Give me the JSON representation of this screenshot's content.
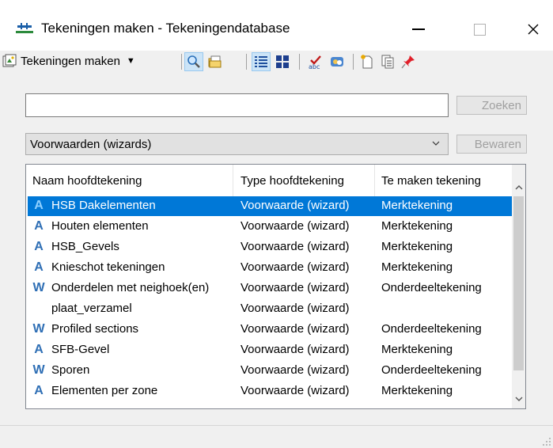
{
  "window": {
    "title": "Tekeningen maken - Tekeningendatabase",
    "app_icon": "drawing-app-icon",
    "controls": [
      "minimize-icon",
      "maximize-icon",
      "close-icon"
    ]
  },
  "toolbar": {
    "dropdown_label": "Tekeningen maken",
    "buttons": [
      {
        "name": "search-icon",
        "active": true
      },
      {
        "name": "folder-open-icon"
      },
      {
        "name": "list-view-icon",
        "active": true
      },
      {
        "name": "grid-view-icon"
      },
      {
        "name": "spellcheck-icon"
      },
      {
        "name": "replace-icon"
      },
      {
        "name": "new-document-icon"
      },
      {
        "name": "copy-document-icon"
      },
      {
        "name": "pin-icon"
      }
    ]
  },
  "search": {
    "value": "",
    "button_label": "Zoeken"
  },
  "filter": {
    "selected": "Voorwaarden (wizards)",
    "save_label": "Bewaren"
  },
  "list": {
    "columns": [
      "Naam hoofdtekening",
      "Type hoofdtekening",
      "Te maken tekening"
    ],
    "rows": [
      {
        "icon": "A",
        "name": "HSB Dakelementen",
        "type": "Voorwaarde (wizard)",
        "target": "Merktekening",
        "selected": true
      },
      {
        "icon": "A",
        "name": "Houten elementen",
        "type": "Voorwaarde (wizard)",
        "target": "Merktekening"
      },
      {
        "icon": "A",
        "name": "HSB_Gevels",
        "type": "Voorwaarde (wizard)",
        "target": "Merktekening"
      },
      {
        "icon": "A",
        "name": "Knieschot tekeningen",
        "type": "Voorwaarde (wizard)",
        "target": "Merktekening"
      },
      {
        "icon": "W",
        "name": "Onderdelen met neighoek(en)",
        "type": "Voorwaarde (wizard)",
        "target": "Onderdeeltekening"
      },
      {
        "icon": "",
        "name": "plaat_verzamel",
        "type": "Voorwaarde (wizard)",
        "target": ""
      },
      {
        "icon": "W",
        "name": "Profiled sections",
        "type": "Voorwaarde (wizard)",
        "target": "Onderdeeltekening"
      },
      {
        "icon": "A",
        "name": "SFB-Gevel",
        "type": "Voorwaarde (wizard)",
        "target": "Merktekening"
      },
      {
        "icon": "W",
        "name": "Sporen",
        "type": "Voorwaarde (wizard)",
        "target": "Onderdeeltekening"
      },
      {
        "icon": "A",
        "name": "Elementen per zone",
        "type": "Voorwaarde (wizard)",
        "target": "Merktekening"
      }
    ]
  },
  "colors": {
    "selection": "#0078d7",
    "icon_blue": "#2f6fb5",
    "window_bg": "#f0f0f0"
  }
}
